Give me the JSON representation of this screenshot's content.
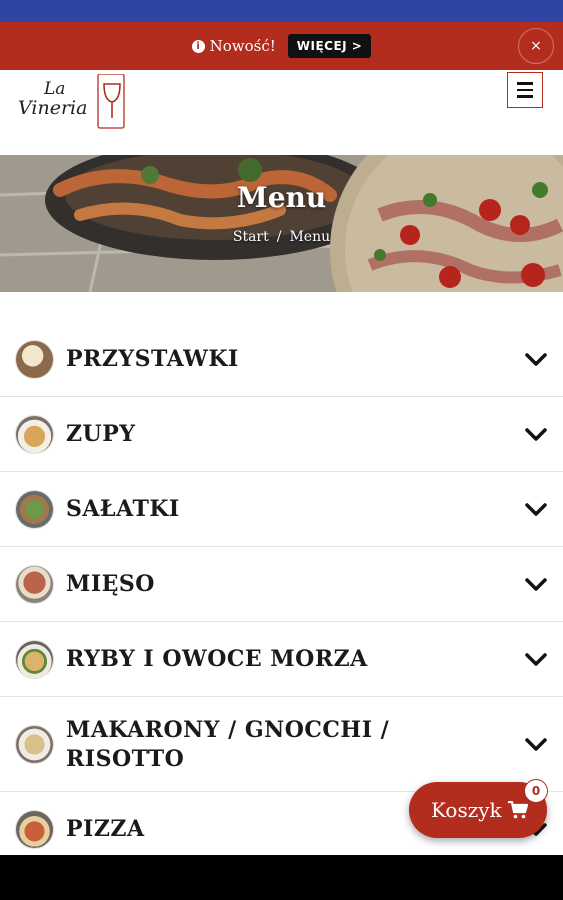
{
  "promo": {
    "text": "Nowość!",
    "button": "WIĘCEJ >",
    "close": "×"
  },
  "logo": {
    "line1": "La",
    "line2": "Vineria"
  },
  "hero": {
    "title": "Menu",
    "breadcrumb_home": "Start",
    "breadcrumb_sep": "/",
    "breadcrumb_current": "Menu"
  },
  "categories": [
    {
      "label": "PRZYSTAWKI",
      "thumb": "#8a6a4a"
    },
    {
      "label": "ZUPY",
      "thumb": "#c89a5a"
    },
    {
      "label": "SAŁATKI",
      "thumb": "#5a7a4a"
    },
    {
      "label": "MIĘSO",
      "thumb": "#a0583a"
    },
    {
      "label": "RYBY I OWOCE MORZA",
      "thumb": "#c4a060"
    },
    {
      "label": "MAKARONY / GNOCCHI / RISOTTO",
      "thumb": "#b89060"
    },
    {
      "label": "PIZZA",
      "thumb": "#c05a3a"
    }
  ],
  "cart": {
    "label": "Koszyk",
    "count": "0"
  },
  "colors": {
    "brand_red": "#b22d1e",
    "status_blue": "#2f45a3"
  }
}
